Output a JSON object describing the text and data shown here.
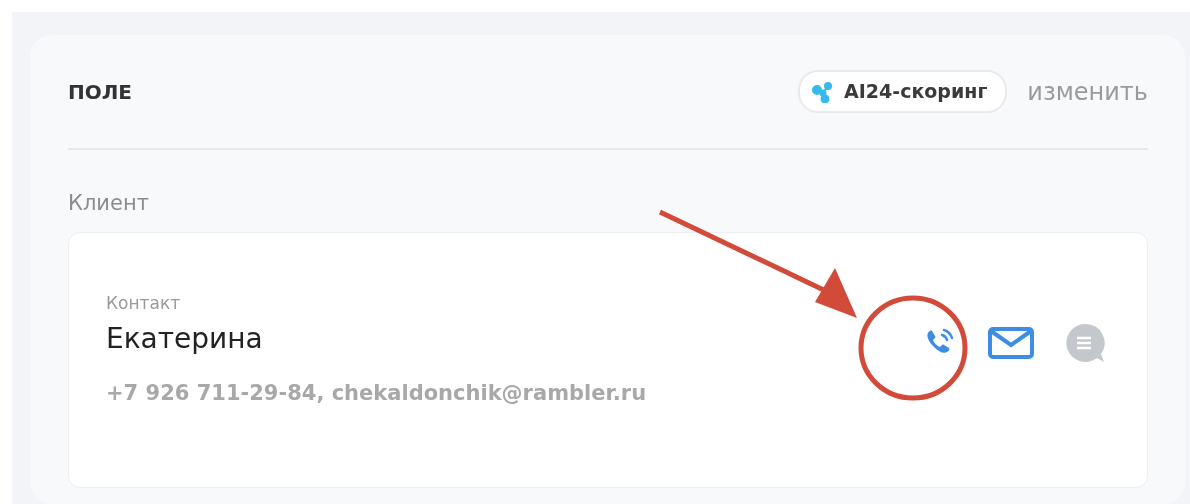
{
  "panel": {
    "title": "ПОЛЕ",
    "scoring_chip": {
      "label": "AI24-скоринг"
    },
    "change_link": "изменить"
  },
  "section_label": "Клиент",
  "contact": {
    "label": "Контакт",
    "name": "Екатерина",
    "details": "+7 926 711-29-84, chekaldonchik@rambler.ru",
    "actions": [
      {
        "kind": "phone",
        "disabled": false
      },
      {
        "kind": "email",
        "disabled": false
      },
      {
        "kind": "chat",
        "disabled": true
      }
    ]
  }
}
